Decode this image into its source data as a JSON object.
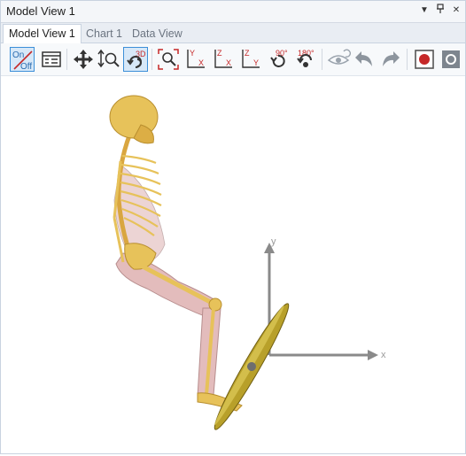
{
  "window": {
    "title": "Model View 1"
  },
  "title_buttons": [
    "dropdown-icon",
    "pin-icon",
    "close-icon"
  ],
  "tabs": [
    {
      "label": "Model View 1",
      "active": true
    },
    {
      "label": "Chart 1",
      "active": false
    },
    {
      "label": "Data View",
      "active": false
    }
  ],
  "toolbar": {
    "on_off": {
      "on": "On",
      "off": "Off"
    },
    "rotate_3d_label": "3D",
    "axis_views": [
      {
        "top": "Y",
        "bottom": "X"
      },
      {
        "top": "Z",
        "bottom": "X"
      },
      {
        "top": "Z",
        "bottom": "Y"
      }
    ],
    "rotate_90_label": "90°",
    "rotate_180_label": "180°"
  },
  "viewport": {
    "axis_labels": {
      "x": "x",
      "y": "y"
    }
  },
  "colors": {
    "accent": "#3c8fd8",
    "record": "#c62828",
    "bone": "#e7c25a",
    "muscle": "#e3bcbc"
  }
}
